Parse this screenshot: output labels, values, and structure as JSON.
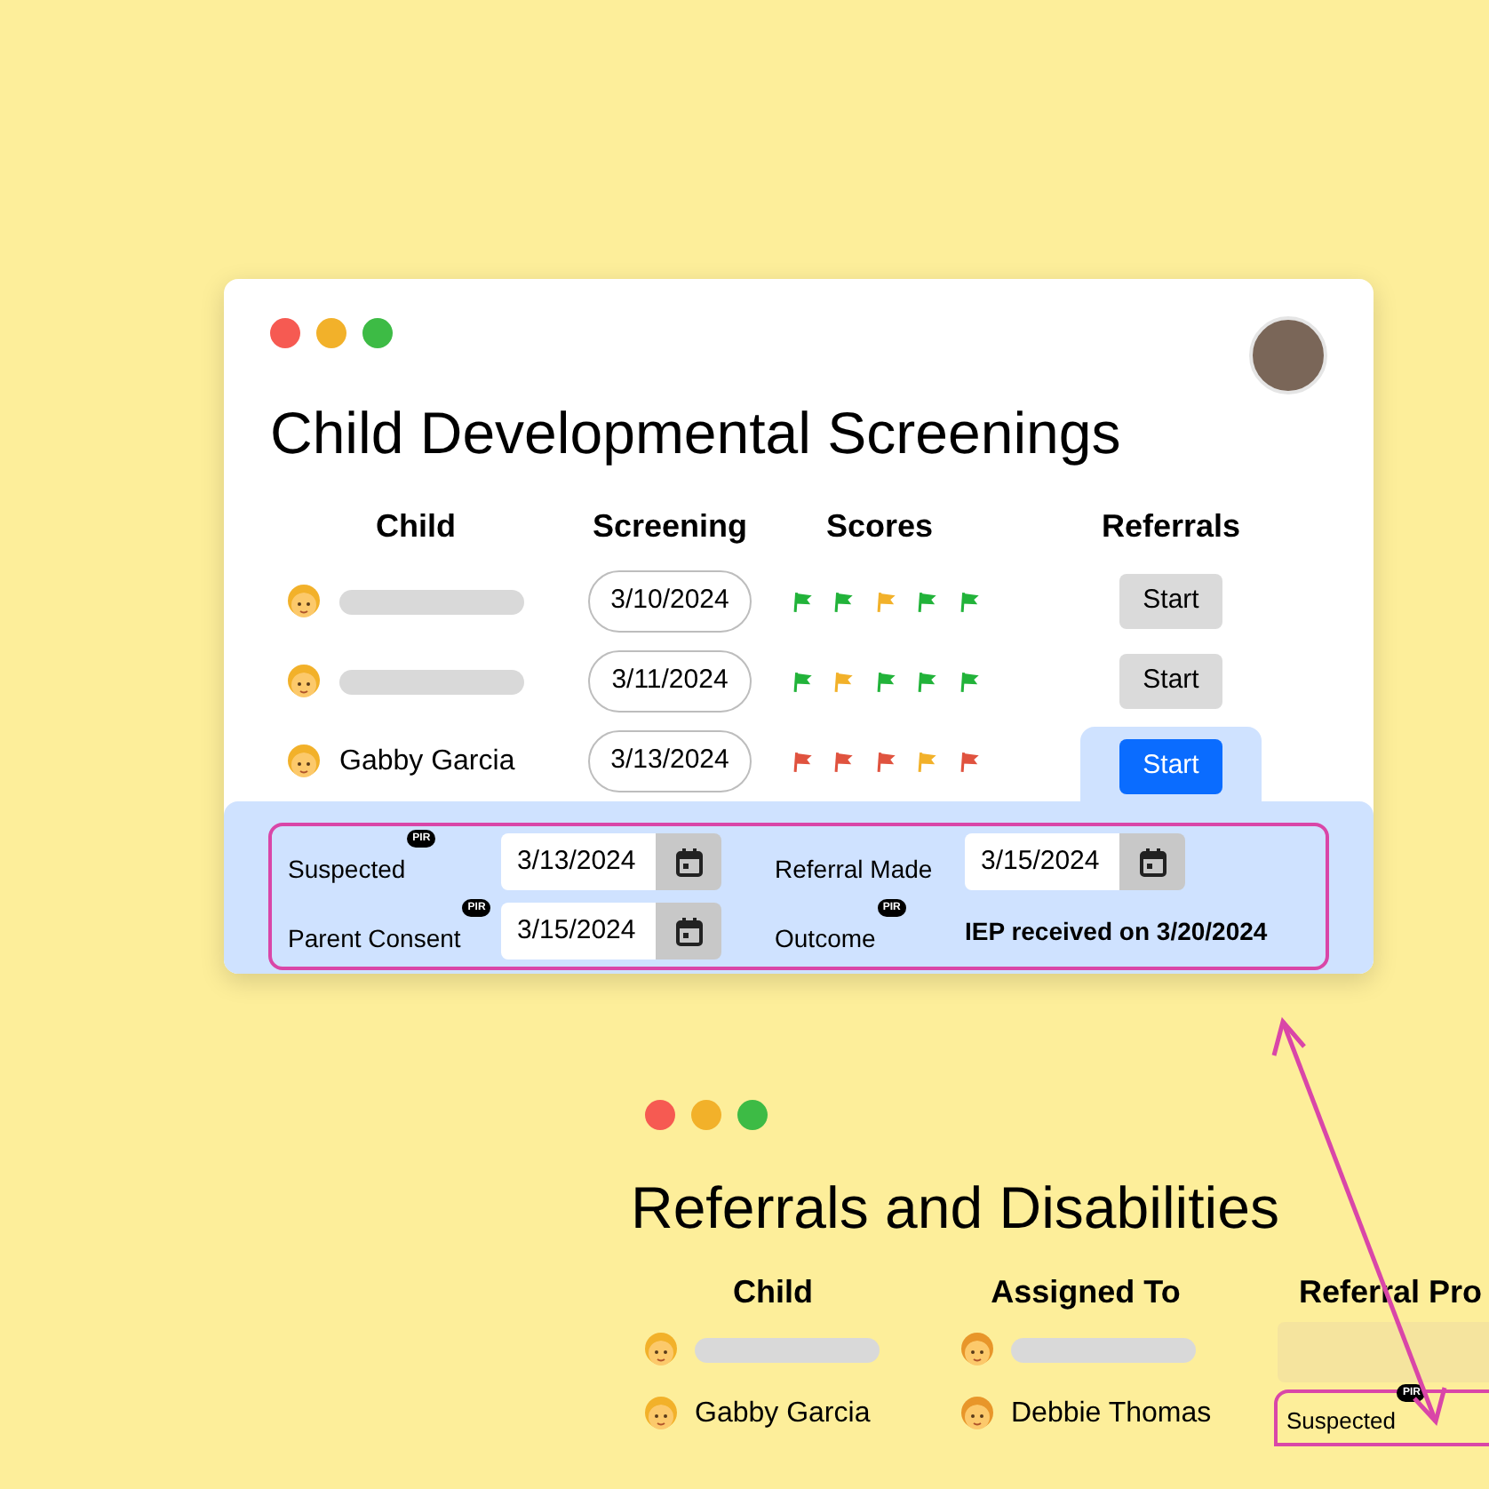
{
  "screenings_window": {
    "title": "Child Developmental Screenings",
    "columns": [
      "Child",
      "Screening",
      "Scores",
      "Referrals"
    ],
    "rows": [
      {
        "redacted": true,
        "screening_date": "3/10/2024",
        "scores": [
          {
            "color": "#22b33a"
          },
          {
            "color": "#22b33a"
          },
          {
            "color": "#f2b12a"
          },
          {
            "color": "#22b33a"
          },
          {
            "color": "#22b33a"
          }
        ],
        "referral_button": {
          "label": "Start",
          "expanded": false
        }
      },
      {
        "redacted": true,
        "screening_date": "3/11/2024",
        "scores": [
          {
            "color": "#22b33a"
          },
          {
            "color": "#f2b12a"
          },
          {
            "color": "#22b33a"
          },
          {
            "color": "#22b33a"
          },
          {
            "color": "#22b33a"
          }
        ],
        "referral_button": {
          "label": "Start",
          "expanded": false
        }
      },
      {
        "redacted": false,
        "name": "Gabby Garcia",
        "screening_date": "3/13/2024",
        "scores": [
          {
            "color": "#e0533f"
          },
          {
            "color": "#e0533f"
          },
          {
            "color": "#e0533f"
          },
          {
            "color": "#f2b12a"
          },
          {
            "color": "#e0533f"
          }
        ],
        "referral_button": {
          "label": "Start",
          "expanded": true
        }
      }
    ],
    "referral_detail": {
      "fields": [
        {
          "label": "Suspected",
          "badge": "PIR",
          "kind": "date",
          "value": "3/13/2024"
        },
        {
          "label": "Referral Made",
          "kind": "date",
          "value": "3/15/2024"
        },
        {
          "label": "Parent Consent",
          "badge": "PIR",
          "kind": "date",
          "value": "3/15/2024"
        },
        {
          "label": "Outcome",
          "badge": "PIR",
          "kind": "text",
          "value": "IEP received on 3/20/2024"
        }
      ]
    }
  },
  "referrals_window": {
    "title": "Referrals and Disabilities",
    "columns": [
      "Child",
      "Assigned To",
      "Referral Pro"
    ],
    "rows": [
      {
        "child_redacted": true,
        "assignee_redacted": true
      },
      {
        "child_redacted": false,
        "child": "Gabby Garcia",
        "assignee_redacted": false,
        "assignee": "Debbie Thomas",
        "referral_field": {
          "label": "Suspected",
          "badge": "PIR"
        }
      }
    ]
  }
}
